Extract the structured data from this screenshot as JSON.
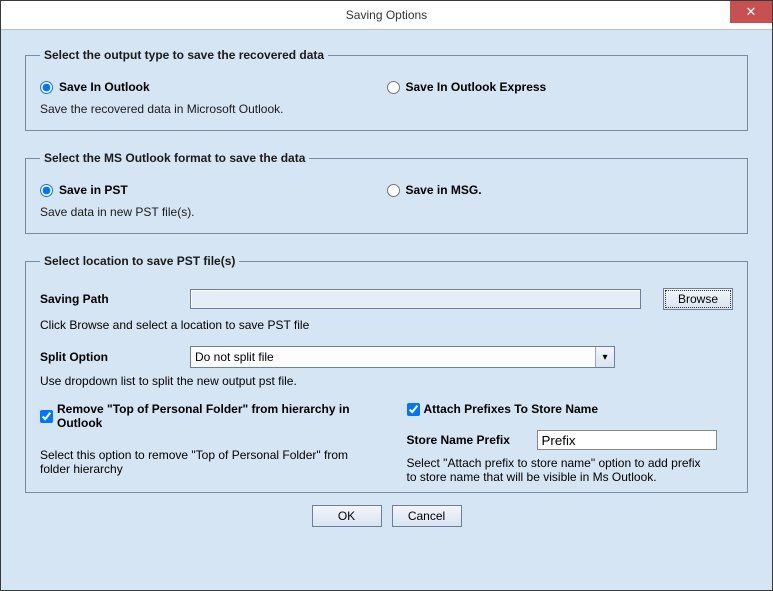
{
  "window": {
    "title": "Saving Options",
    "close_glyph": "✕"
  },
  "groups": {
    "output_type": {
      "legend": "Select the output type to save the recovered data",
      "opt_outlook": "Save In Outlook",
      "opt_outlook_express": "Save In Outlook Express",
      "desc": "Save the recovered data in Microsoft Outlook."
    },
    "format": {
      "legend": "Select the MS Outlook format to save the data",
      "opt_pst": "Save in PST",
      "opt_msg": "Save in MSG.",
      "desc": "Save data in new PST file(s)."
    },
    "location": {
      "legend": "Select location to save PST file(s)",
      "saving_path_label": "Saving Path",
      "saving_path_value": "",
      "browse": "Browse",
      "browse_hint": "Click Browse and select a location to save PST file",
      "split_label": "Split Option",
      "split_value": "Do not split file",
      "split_hint": "Use dropdown list to split the new output pst file.",
      "remove_top_label": "Remove \"Top of Personal Folder\" from hierarchy in Outlook",
      "remove_top_hint": "Select this option to remove \"Top of Personal Folder\" from folder hierarchy",
      "attach_prefix_label": "Attach Prefixes To Store Name",
      "store_prefix_label": "Store Name Prefix",
      "store_prefix_value": "Prefix",
      "attach_prefix_hint": "Select \"Attach prefix to store name\" option to add prefix to store name that will be visible in Ms Outlook."
    }
  },
  "buttons": {
    "ok": "OK",
    "cancel": "Cancel"
  },
  "select_arrow": "▾"
}
